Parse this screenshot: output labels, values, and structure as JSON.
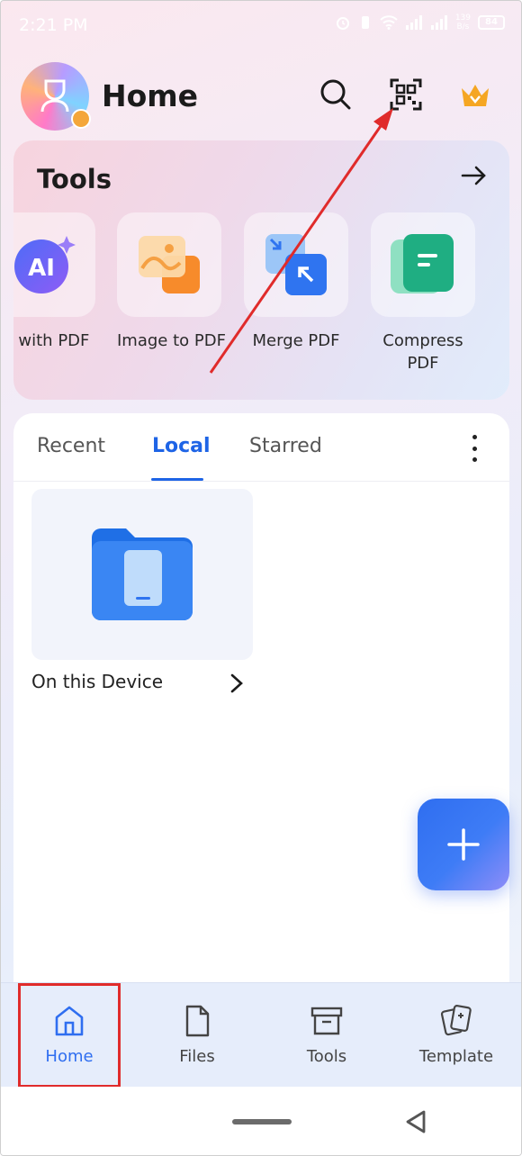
{
  "status_bar": {
    "time": "2:21 PM",
    "net_speed_top": "139",
    "net_speed_bottom": "B/s",
    "battery": "84"
  },
  "header": {
    "title": "Home"
  },
  "tools": {
    "title": "Tools",
    "items": [
      {
        "label": "at with PDF",
        "icon": "ai-chat-icon"
      },
      {
        "label": "Image to PDF",
        "icon": "image-to-pdf-icon"
      },
      {
        "label": "Merge PDF",
        "icon": "merge-pdf-icon"
      },
      {
        "label": "Compress",
        "label2": "PDF",
        "icon": "compress-pdf-icon"
      }
    ]
  },
  "tabs": {
    "recent": "Recent",
    "local": "Local",
    "starred": "Starred",
    "active": "Local"
  },
  "local": {
    "device_label": "On this Device"
  },
  "bottom_nav": {
    "items": [
      {
        "label": "Home",
        "active": true
      },
      {
        "label": "Files",
        "active": false
      },
      {
        "label": "Tools",
        "active": false
      },
      {
        "label": "Template",
        "active": false
      }
    ]
  },
  "colors": {
    "accent": "#1e64e6",
    "annotation": "#e02b2b",
    "nav_bg": "#e6edfb"
  }
}
